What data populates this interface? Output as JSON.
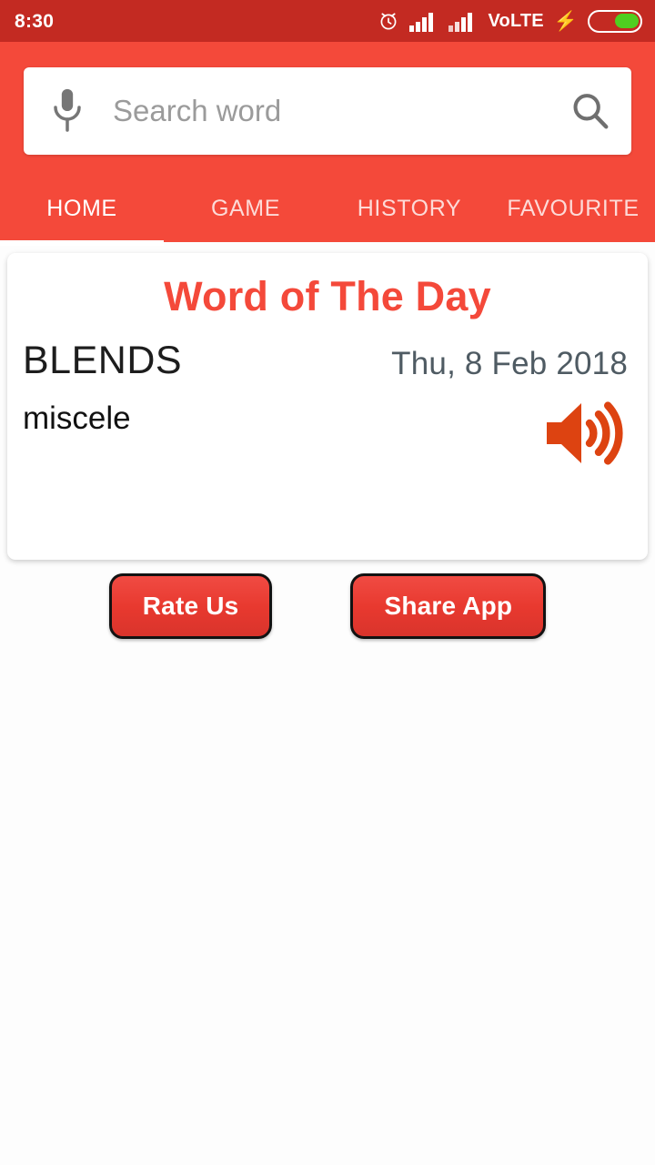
{
  "status_bar": {
    "time": "8:30",
    "alarm_icon": "alarm-clock-icon",
    "signal_1_icon": "signal-bars-icon",
    "signal_2_icon": "signal-bars-icon",
    "network_label": "VoLTE",
    "charging_icon": "lightning-bolt-icon",
    "battery_icon": "battery-icon",
    "background_color": "#C32A22",
    "battery_fill_color": "#4FCE20"
  },
  "header": {
    "background_color": "#F4493A",
    "search": {
      "placeholder": "Search word",
      "value": "",
      "mic_icon": "microphone-icon",
      "search_icon": "search-icon"
    },
    "tabs": [
      {
        "label": "HOME",
        "active": true
      },
      {
        "label": "GAME",
        "active": false
      },
      {
        "label": "HISTORY",
        "active": false
      },
      {
        "label": "FAVOURITE",
        "active": false
      }
    ]
  },
  "card": {
    "title": "Word of The Day",
    "title_color": "#F4493A",
    "word": "BLENDS",
    "meaning": "miscele",
    "date": "Thu, 8 Feb 2018",
    "date_color": "#4F5B63",
    "speaker_icon": "speaker-volume-icon",
    "speaker_color": "#DD4311"
  },
  "actions": {
    "rate_label": "Rate Us",
    "share_label": "Share App",
    "button_color": "#E8392F"
  }
}
